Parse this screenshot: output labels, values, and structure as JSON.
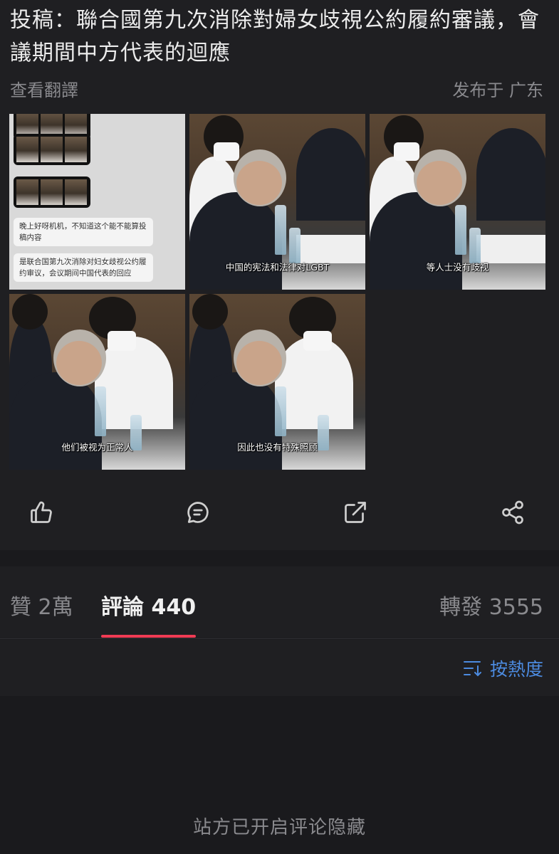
{
  "post": {
    "title": "投稿：聯合國第九次消除對婦女歧視公約履約審議，會議期間中方代表的迴應",
    "translate_link": "查看翻譯",
    "published": "发布于 广东",
    "images": {
      "chat": {
        "msg1": "晚上好呀机机，不知道这个能不能算投稿内容",
        "msg2": "是联合国第九次消除对妇女歧视公约履约审议，会议期间中国代表的回应"
      },
      "subtitles": [
        "中国的宪法和法律对LGBT",
        "等人士没有歧视",
        "他们被视为正常人",
        "因此也没有特殊照顾"
      ]
    }
  },
  "actions": {
    "icons": [
      "thumbs-up-icon",
      "comment-icon",
      "external-link-icon",
      "share-icon"
    ]
  },
  "tabs": {
    "likes": "贊 2萬",
    "comments": "評論 440",
    "reposts": "轉發 3555"
  },
  "sort": {
    "label": "按熱度"
  },
  "comments_notice": "站方已开启评论隐藏",
  "colors": {
    "accent": "#ef3b54",
    "link": "#4c8be0",
    "background": "#1a1a1d"
  }
}
